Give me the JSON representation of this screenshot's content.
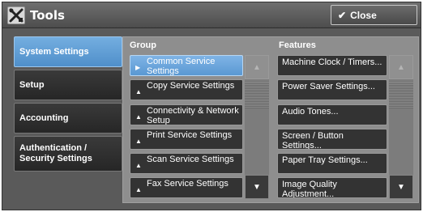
{
  "window": {
    "title": "Tools",
    "close_label": "Close"
  },
  "tabs": [
    {
      "label": "System Settings",
      "active": true
    },
    {
      "label": "Setup",
      "active": false
    },
    {
      "label": "Accounting",
      "active": false
    },
    {
      "label": "Authentication / Security Settings",
      "active": false
    }
  ],
  "group": {
    "header": "Group",
    "items": [
      {
        "label": "Common Service Settings",
        "selected": true
      },
      {
        "label": "Copy Service Settings",
        "selected": false
      },
      {
        "label": "Connectivity & Network Setup",
        "selected": false
      },
      {
        "label": "Print Service Settings",
        "selected": false
      },
      {
        "label": "Scan Service Settings",
        "selected": false
      },
      {
        "label": "Fax Service Settings",
        "selected": false
      }
    ]
  },
  "features": {
    "header": "Features",
    "items": [
      {
        "label": "Machine Clock / Timers..."
      },
      {
        "label": "Power Saver Settings..."
      },
      {
        "label": "Audio Tones..."
      },
      {
        "label": "Screen / Button Settings..."
      },
      {
        "label": "Paper Tray Settings..."
      },
      {
        "label": "Image Quality Adjustment..."
      }
    ]
  },
  "icons": {
    "title": "tools-icon",
    "close": "check-icon",
    "scroll_up": "triangle-up-icon",
    "scroll_down": "triangle-down-icon"
  },
  "colors": {
    "selected": "#5a98d2",
    "item_bg": "#333333",
    "panel_bg": "#8e8e8e"
  }
}
